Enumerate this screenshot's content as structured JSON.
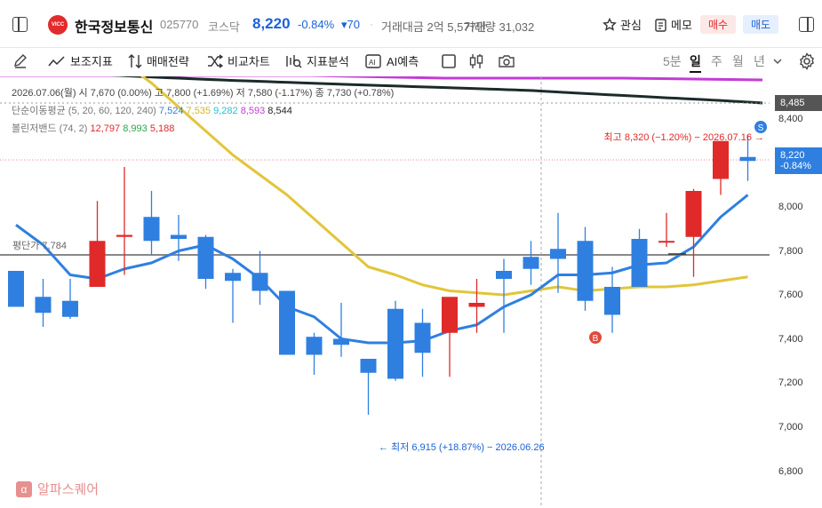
{
  "header": {
    "logo_text": "VICC",
    "stock_name": "한국정보통신",
    "code": "025770",
    "market": "코스닥",
    "price": "8,220",
    "change_pct": "-0.84%",
    "change_abs": "▾70",
    "trade_value": "거래대금 2억 5,577만",
    "trade_volume": "거래량 31,032",
    "watch_label": "관심",
    "memo_label": "메모",
    "buy_label": "매수",
    "sell_label": "매도",
    "accent_up": "#e02929",
    "accent_down": "#1a62d8"
  },
  "toolbar": {
    "indicator_label": "보조지표",
    "strategy_label": "매매전략",
    "compare_label": "비교차트",
    "analysis_label": "지표분석",
    "ai_label": "AI예측",
    "timeframes": [
      "5분",
      "일",
      "주",
      "월",
      "년"
    ],
    "active_timeframe": "일"
  },
  "info": {
    "date_line": "2026.07.06(월)  시 7,670 (0.00%)  고 7,800 (+1.69%)  저 7,580 (-1.17%)  종 7,730 (+0.78%)",
    "ma_label": "단순이동평균 (5, 20, 60, 120, 240)",
    "ma_values": [
      "7,524",
      "7,535",
      "9,282",
      "8,593",
      "8,544"
    ],
    "bb_label": "볼린저밴드 (74, 2)",
    "bb_values": [
      "12,797",
      "8,993",
      "5,188"
    ]
  },
  "annotations": {
    "avg_price": "평단가 7,784",
    "high": "최고 8,320 (−1.20%) − 2026.07.16 →",
    "low": "← 최저 6,915 (+18.87%) − 2026.06.26",
    "marker_s": "S",
    "marker_b": "B"
  },
  "price_axis": {
    "labels": [
      "8,400",
      "8,200",
      "8,000",
      "7,800",
      "7,600",
      "7,400",
      "7,200",
      "7,000",
      "6,800"
    ],
    "tag_top": "8,485",
    "tag_cur_price": "8,220",
    "tag_cur_pct": "-0.84%"
  },
  "watermark": "알파스퀘어",
  "chart_data": {
    "type": "candlestick",
    "ylim": [
      6720,
      8570
    ],
    "candles": [
      {
        "o": 7640,
        "h": 7640,
        "l": 7460,
        "c": 7460
      },
      {
        "o": 7510,
        "h": 7600,
        "l": 7360,
        "c": 7430
      },
      {
        "o": 7490,
        "h": 7600,
        "l": 7400,
        "c": 7410
      },
      {
        "o": 7560,
        "h": 7990,
        "l": 7560,
        "c": 7790
      },
      {
        "o": 7810,
        "h": 8160,
        "l": 7620,
        "c": 7820
      },
      {
        "o": 7910,
        "h": 8040,
        "l": 7720,
        "c": 7790
      },
      {
        "o": 7820,
        "h": 7920,
        "l": 7690,
        "c": 7800
      },
      {
        "o": 7810,
        "h": 7820,
        "l": 7550,
        "c": 7600
      },
      {
        "o": 7630,
        "h": 7650,
        "l": 7380,
        "c": 7590
      },
      {
        "o": 7630,
        "h": 7740,
        "l": 7470,
        "c": 7540
      },
      {
        "o": 7540,
        "h": 7540,
        "l": 7220,
        "c": 7220
      },
      {
        "o": 7310,
        "h": 7330,
        "l": 7120,
        "c": 7220
      },
      {
        "o": 7300,
        "h": 7480,
        "l": 7210,
        "c": 7270
      },
      {
        "o": 7200,
        "h": 7200,
        "l": 6920,
        "c": 7130
      },
      {
        "o": 7450,
        "h": 7490,
        "l": 7090,
        "c": 7100
      },
      {
        "o": 7380,
        "h": 7450,
        "l": 7110,
        "c": 7230
      },
      {
        "o": 7330,
        "h": 7500,
        "l": 7110,
        "c": 7510
      },
      {
        "o": 7460,
        "h": 7600,
        "l": 7330,
        "c": 7480
      },
      {
        "o": 7640,
        "h": 7700,
        "l": 7330,
        "c": 7600
      },
      {
        "o": 7710,
        "h": 7790,
        "l": 7570,
        "c": 7650
      },
      {
        "o": 7750,
        "h": 7930,
        "l": 7530,
        "c": 7700
      },
      {
        "o": 7790,
        "h": 7860,
        "l": 7440,
        "c": 7490
      },
      {
        "o": 7560,
        "h": 7660,
        "l": 7330,
        "c": 7420
      },
      {
        "o": 7800,
        "h": 7850,
        "l": 7560,
        "c": 7560
      },
      {
        "o": 7790,
        "h": 7930,
        "l": 7760,
        "c": 7790
      },
      {
        "o": 7810,
        "h": 8050,
        "l": 7610,
        "c": 8040
      },
      {
        "o": 8100,
        "h": 8280,
        "l": 8020,
        "c": 8290
      },
      {
        "o": 8210,
        "h": 8320,
        "l": 8090,
        "c": 8190
      }
    ],
    "ma5": [
      7870,
      7770,
      7620,
      7600,
      7650,
      7680,
      7740,
      7770,
      7700,
      7600,
      7460,
      7410,
      7300,
      7280,
      7280,
      7290,
      7340,
      7370,
      7460,
      7520,
      7620,
      7620,
      7630,
      7670,
      7680,
      7760,
      7910,
      8020
    ],
    "ma20": [
      9040,
      8960,
      8880,
      8780,
      8680,
      8580,
      8460,
      8340,
      8220,
      8120,
      8020,
      7900,
      7780,
      7660,
      7620,
      7570,
      7540,
      7530,
      7520,
      7540,
      7560,
      7540,
      7550,
      7560,
      7560,
      7570,
      7590,
      7610
    ]
  }
}
